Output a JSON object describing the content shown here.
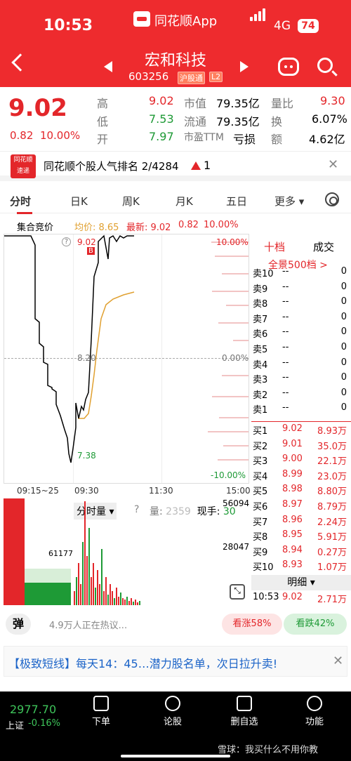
{
  "status": {
    "time": "10:53",
    "app": "同花顺App",
    "network": "4G",
    "battery": "74"
  },
  "header": {
    "name": "宏和科技",
    "code": "603256",
    "tag1": "沪股通",
    "tag2": "L2"
  },
  "quote": {
    "price": "9.02",
    "change": "0.82",
    "pct": "10.00%",
    "high_l": "高",
    "high": "9.02",
    "low_l": "低",
    "low": "7.53",
    "open_l": "开",
    "open": "7.97",
    "mcap_l": "市值",
    "mcap": "79.35亿",
    "float_l": "流通",
    "float": "79.35亿",
    "pe_l": "市盈TTM",
    "pe": "亏损",
    "vr_l": "量比",
    "vr": "9.30",
    "turn_l": "换",
    "turn": "6.07%",
    "amt_l": "额",
    "amt": "4.62亿"
  },
  "notice": {
    "logo1": "同花顺",
    "logo2": "速递",
    "text": "同花顺个股人气排名 2/4284",
    "rank": "1"
  },
  "tabs": [
    "分时",
    "日K",
    "周K",
    "月K",
    "五日",
    "更多"
  ],
  "info": {
    "auction": "集合竞价",
    "avg": "均价: 8.65",
    "latest": "最新: 9.02",
    "chg": "0.82",
    "pct": "10.00%"
  },
  "chart": {
    "top_price": "9.02",
    "b_mark": "B",
    "top_pct": "10.00%",
    "mid_price": "8.20",
    "mid_pct": "0.00%",
    "low_price": "7.38",
    "low_pct": "-10.00%",
    "times": [
      "09:15~25",
      "09:30",
      "11:30",
      "15:00"
    ],
    "colors": {
      "price": "#000000",
      "avg": "#e0a030"
    }
  },
  "orderbook": {
    "tab1": "十档",
    "tab2": "成交",
    "full": "全景500档 >",
    "asks": [
      {
        "l": "卖10",
        "p": "--",
        "v": "0"
      },
      {
        "l": "卖9",
        "p": "--",
        "v": "0"
      },
      {
        "l": "卖8",
        "p": "--",
        "v": "0"
      },
      {
        "l": "卖7",
        "p": "--",
        "v": "0"
      },
      {
        "l": "卖6",
        "p": "--",
        "v": "0"
      },
      {
        "l": "卖5",
        "p": "--",
        "v": "0"
      },
      {
        "l": "卖4",
        "p": "--",
        "v": "0"
      },
      {
        "l": "卖3",
        "p": "--",
        "v": "0"
      },
      {
        "l": "卖2",
        "p": "--",
        "v": "0"
      },
      {
        "l": "卖1",
        "p": "--",
        "v": "0"
      }
    ],
    "bids": [
      {
        "l": "买1",
        "p": "9.02",
        "v": "8.93万"
      },
      {
        "l": "买2",
        "p": "9.01",
        "v": "35.0万"
      },
      {
        "l": "买3",
        "p": "9.00",
        "v": "22.1万"
      },
      {
        "l": "买4",
        "p": "8.99",
        "v": "23.0万"
      },
      {
        "l": "买5",
        "p": "8.98",
        "v": "8.80万"
      },
      {
        "l": "买6",
        "p": "8.97",
        "v": "8.79万"
      },
      {
        "l": "买7",
        "p": "8.96",
        "v": "2.24万"
      },
      {
        "l": "买8",
        "p": "8.95",
        "v": "5.91万"
      },
      {
        "l": "买9",
        "p": "8.94",
        "v": "0.27万"
      },
      {
        "l": "买10",
        "p": "8.93",
        "v": "1.07万"
      }
    ],
    "detail": "明细",
    "last_time": "10:53",
    "last_price": "9.02",
    "last_vol": "2.71万"
  },
  "volume": {
    "mode": "分时量",
    "qty_l": "量:",
    "qty": "2359",
    "hand_l": "现手:",
    "hand": "30",
    "top": "56094",
    "mid": "28047",
    "left_val": "61177"
  },
  "bar": {
    "dan": "弹",
    "hot": "4.9万人正在热议...",
    "up": "看涨58%",
    "down": "看跌42%"
  },
  "ad": {
    "text": "【极致短线】每天14：45…潜力股名单，次日拉升卖!"
  },
  "bottom": {
    "index": "2977.70",
    "index_l": "上证",
    "index_chg": "-0.16%",
    "items": [
      "下单",
      "论股",
      "删自选",
      "功能"
    ],
    "watermark": "雪球：我买什么不用你教"
  }
}
